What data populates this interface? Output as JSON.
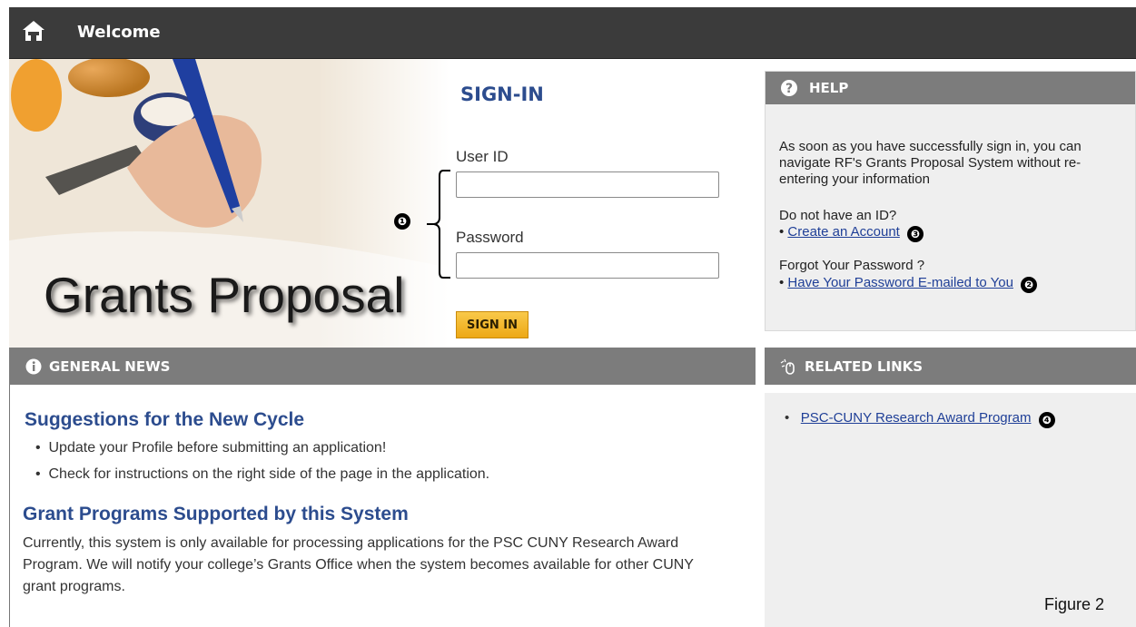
{
  "topbar": {
    "title": "Welcome",
    "home_icon": "home-icon"
  },
  "hero": {
    "title": "Grants Proposal"
  },
  "signin": {
    "heading": "SIGN-IN",
    "user_id_label": "User ID",
    "user_id_value": "",
    "password_label": "Password",
    "password_value": "",
    "button_label": "SIGN IN"
  },
  "help": {
    "header": "HELP",
    "intro": "As soon as you have successfully sign in, you can navigate RF's Grants Proposal System without re-entering your information",
    "no_id_text": "Do not have an ID?",
    "create_account_link": "Create an Account",
    "forgot_text": "Forgot Your Password ?",
    "email_password_link": "Have Your Password E-mailed to You"
  },
  "general_news": {
    "header": "GENERAL NEWS",
    "heading1": "Suggestions for the New Cycle",
    "bullets": [
      "Update your Profile before submitting an application!",
      "Check for instructions on the right side of the page in the application."
    ],
    "heading2": "Grant Programs Supported by this System",
    "body": "Currently, this system is only available for processing applications for the PSC CUNY Research Award Program. We will notify your college’s Grants Office when the system becomes available for other CUNY grant programs."
  },
  "related_links": {
    "header": "RELATED LINKS",
    "links": [
      "PSC-CUNY Research Award Program"
    ]
  },
  "callouts": [
    "❶",
    "❷",
    "❸",
    "❹"
  ],
  "figure_label": "Figure 2",
  "colors": {
    "accent_blue": "#2c4c8e",
    "link_blue": "#1f3f97",
    "bar_gray": "#7c7c7c",
    "topbar": "#3b3b3b",
    "button_gold": "#f2b324"
  }
}
